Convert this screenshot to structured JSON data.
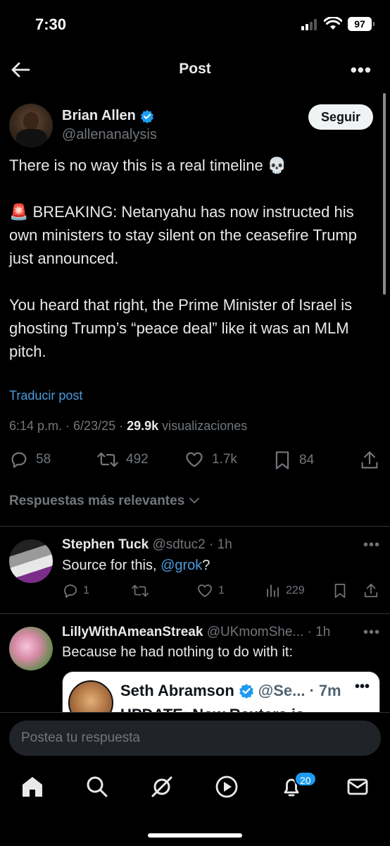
{
  "status_bar": {
    "time": "7:30",
    "battery": "97"
  },
  "header": {
    "title": "Post"
  },
  "post": {
    "author_name": "Brian Allen",
    "author_handle": "@allenanalysis",
    "follow_label": "Seguir",
    "text": "There is no way this is a real timeline 💀\n\n🚨 BREAKING: Netanyahu has now instructed his own ministers to stay silent on the ceasefire Trump just announced.\n\nYou heard that right, the Prime Minister of Israel is ghosting Trump’s “peace deal” like it was an MLM pitch.",
    "translate_label": "Traducir post",
    "time": "6:14 p.m.",
    "date": "6/23/25",
    "views_count": "29.9k",
    "views_label": "visualizaciones",
    "replies": "58",
    "reposts": "492",
    "likes": "1.7k",
    "bookmarks": "84"
  },
  "replies_sort_label": "Respuestas más relevantes",
  "replies": [
    {
      "name": "Stephen Tuck",
      "handle": "@sdtuc2",
      "age": "1h",
      "text": "Source for this, ",
      "mention": "@grok",
      "text_end": "?",
      "reply_count": "1",
      "like_count": "1",
      "views": "229"
    },
    {
      "name": "LillyWithAmeanStreak",
      "handle": "@UKmomShe...",
      "age": "1h",
      "text": "Because he had nothing to do with it:",
      "quote": {
        "name": "Seth Abramson",
        "handle": "@Se...",
        "age": "7m",
        "text": "UPDATE: Now Reuters is"
      }
    }
  ],
  "composer": {
    "placeholder": "Postea tu respuesta"
  },
  "nav": {
    "notifications_badge": "20"
  },
  "colors": {
    "accent": "#1d9bf0",
    "link": "#4c9bdf",
    "muted": "#71767b",
    "text": "#e7e9ea",
    "background": "#000000"
  }
}
